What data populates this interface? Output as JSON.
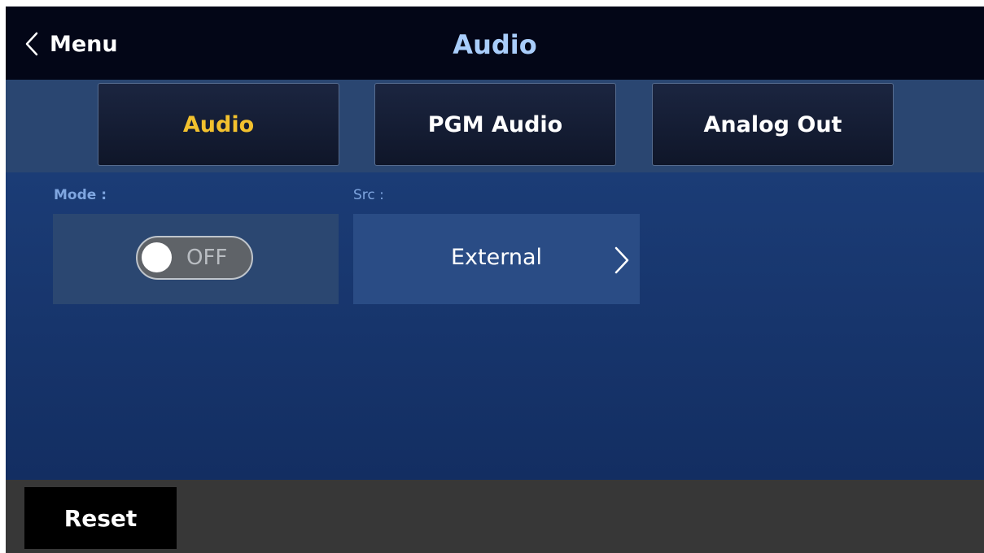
{
  "header": {
    "back_label": "Menu",
    "back_icon": "chevron-left-icon",
    "title": "Audio"
  },
  "tabs": [
    {
      "label": "Audio",
      "active": true
    },
    {
      "label": "PGM Audio",
      "active": false
    },
    {
      "label": "Analog Out",
      "active": false
    }
  ],
  "fields": {
    "mode": {
      "label": "Mode :",
      "value": "OFF",
      "state": "off"
    },
    "src": {
      "label": "Src :",
      "value": "External",
      "icon": "chevron-right-icon"
    }
  },
  "footer": {
    "reset_label": "Reset"
  },
  "colors": {
    "active_tab": "#f2c12e",
    "title": "#a9cdfb",
    "content_bg": "#1b3c76"
  }
}
